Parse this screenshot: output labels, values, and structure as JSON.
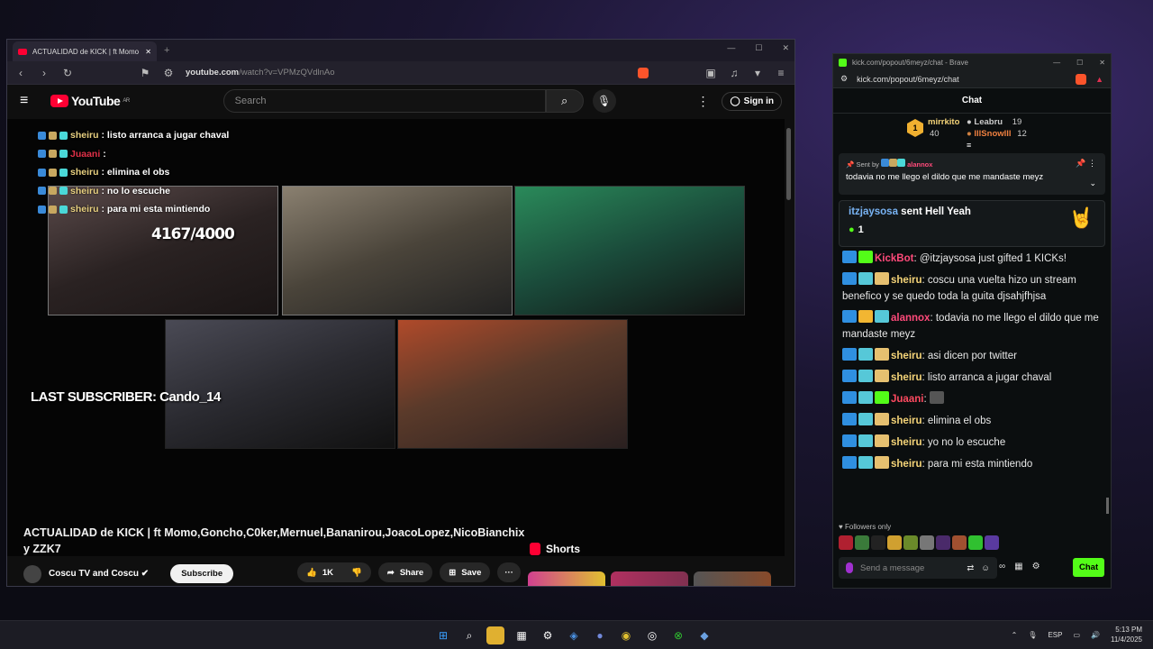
{
  "yt_window": {
    "tab_title": "ACTUALIDAD de KICK | ft Momo",
    "new_tab": "+",
    "url_domain": "youtube.com",
    "url_path": "/watch?v=VPMzQVdlnAo",
    "logo_text": "YouTube",
    "logo_region": "AR",
    "search_placeholder": "Search",
    "sign_in": "Sign in",
    "overlay_chat": [
      {
        "user": "sheiru",
        "text": " : listo arranca a jugar chaval",
        "color": "gold"
      },
      {
        "user": "Juaani",
        "text": " : ",
        "color": "red"
      },
      {
        "user": "sheiru",
        "text": " : elimina el obs",
        "color": "gold"
      },
      {
        "user": "sheiru",
        "text": " :       no lo escuche",
        "color": "gold"
      },
      {
        "user": "sheiru",
        "text": " : para mi esta mintiendo",
        "color": "gold"
      }
    ],
    "subs_counter": "4167/4000",
    "last_subscriber": "LAST SUBSCRIBER: Cando_14",
    "video_title": "ACTUALIDAD de KICK | ft Momo,Goncho,C0ker,Mernuel,Bananirou,JoacoLopez,NicoBianchix y ZZK7",
    "channel_name": "Coscu TV and Coscu",
    "subscribe": "Subscribe",
    "likes": "1K",
    "share": "Share",
    "save": "Save",
    "shorts": "Shorts"
  },
  "kick_window": {
    "tab_title": "kick.com/popout/6meyz/chat - Brave",
    "url": "kick.com/popout/6meyz/chat",
    "chat_header": "Chat",
    "leaderboard": {
      "rank": "1",
      "first": {
        "name": "mirrkito",
        "value": "40"
      },
      "second": {
        "name": "Leabru",
        "value": "19"
      },
      "third": {
        "name": "lllSnowlll",
        "value": "12"
      }
    },
    "pinned": {
      "sent_by_label": "Sent by",
      "sent_by_user": "alannox",
      "text": "todavia no me llego el dildo que me mandaste meyz"
    },
    "gift": {
      "user": "itzjaysosa",
      "action": " sent Hell Yeah",
      "count": "1"
    },
    "messages": [
      {
        "user": "KickBot",
        "text": ": @itzjaysosa just gifted 1 KICKs!",
        "style": "pink"
      },
      {
        "user": "sheiru",
        "text": ": coscu una vuelta hizo un stream benefico y se quedo toda la guita djsahjfhjsa",
        "style": "gold"
      },
      {
        "user": "alannox",
        "text": ": todavia no me llego el dildo que me mandaste meyz",
        "style": "pink"
      },
      {
        "user": "sheiru",
        "text": ": asi dicen por twitter",
        "style": "gold"
      },
      {
        "user": "sheiru",
        "text": ": listo arranca a jugar chaval",
        "style": "gold"
      },
      {
        "user": "Juaani",
        "text": ":",
        "style": "red"
      },
      {
        "user": "sheiru",
        "text": ": elimina el obs",
        "style": "gold"
      },
      {
        "user": "sheiru",
        "text": ": yo no lo escuche",
        "style": "gold"
      },
      {
        "user": "sheiru",
        "text": ": para mi esta mintiendo",
        "style": "gold"
      }
    ],
    "followers_only": "Followers only",
    "input_placeholder": "Send a message",
    "chat_button": "Chat"
  },
  "taskbar": {
    "lang": "ESP",
    "time": "5:13 PM",
    "date": "11/4/2025"
  },
  "colors": {
    "youtube_red": "#ff0033",
    "kick_green": "#53fc18"
  }
}
